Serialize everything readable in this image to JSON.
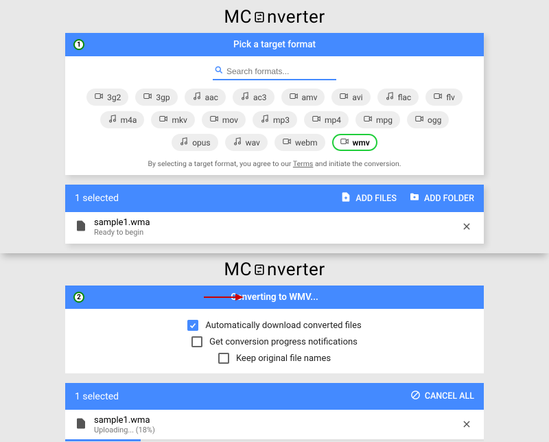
{
  "app": {
    "title_pre": "MC",
    "title_post": "nverter"
  },
  "step1": {
    "badge": "1",
    "title": "Pick a target format",
    "search_placeholder": "Search formats...",
    "formats": [
      {
        "label": "3g2",
        "icon": "video"
      },
      {
        "label": "3gp",
        "icon": "video"
      },
      {
        "label": "aac",
        "icon": "audio"
      },
      {
        "label": "ac3",
        "icon": "audio"
      },
      {
        "label": "amv",
        "icon": "video"
      },
      {
        "label": "avi",
        "icon": "video"
      },
      {
        "label": "flac",
        "icon": "audio"
      },
      {
        "label": "flv",
        "icon": "video"
      },
      {
        "label": "m4a",
        "icon": "audio"
      },
      {
        "label": "mkv",
        "icon": "video"
      },
      {
        "label": "mov",
        "icon": "video"
      },
      {
        "label": "mp3",
        "icon": "audio"
      },
      {
        "label": "mp4",
        "icon": "video"
      },
      {
        "label": "mpg",
        "icon": "video"
      },
      {
        "label": "ogg",
        "icon": "video"
      },
      {
        "label": "opus",
        "icon": "audio"
      },
      {
        "label": "wav",
        "icon": "audio"
      },
      {
        "label": "webm",
        "icon": "video"
      },
      {
        "label": "wmv",
        "icon": "video",
        "selected": true
      }
    ],
    "terms_pre": "By selecting a target format, you agree to our ",
    "terms_link": "Terms",
    "terms_post": " and initiate the conversion.",
    "selected_count": "1 selected",
    "add_files": "ADD FILES",
    "add_folder": "ADD FOLDER",
    "file": {
      "name": "sample1.wma",
      "status": "Ready to begin"
    }
  },
  "step2": {
    "badge": "2",
    "title": "Converting to WMV...",
    "opt_auto": "Automatically download converted files",
    "opt_notify": "Get conversion progress notifications",
    "opt_keep": "Keep original file names",
    "selected_count": "1 selected",
    "cancel_all": "CANCEL ALL",
    "file": {
      "name": "sample1.wma",
      "status": "Uploading... (18%)",
      "progress": 18
    }
  }
}
